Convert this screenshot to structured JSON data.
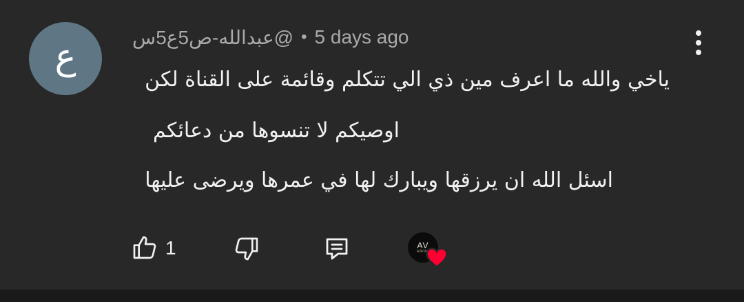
{
  "comment": {
    "author_initial": "ع",
    "author_handle": "@عبدالله-ص5ع5س",
    "separator": "•",
    "timestamp": "5 days ago",
    "text_lines": [
      "ياخي والله ما اعرف مين ذي الي تتكلم وقائمة على القناة لكن",
      "اوصيكم لا تنسوها من دعائكم",
      "اسئل الله ان يرزقها ويبارك لها في عمرها ويرضى عليها"
    ]
  },
  "actions": {
    "like_count": "1",
    "icons": [
      "thumbs-up-icon",
      "thumbs-down-icon",
      "reply-icon",
      "creator-heart-icon"
    ]
  },
  "creator_badge": {
    "logo_text": "AV",
    "logo_subtext": "AVATAR"
  },
  "colors": {
    "background": "#282828",
    "text_primary": "#f1f1f1",
    "text_secondary": "#aaaaaa",
    "avatar_bg": "#5f7785",
    "heart": "#ff0033"
  }
}
